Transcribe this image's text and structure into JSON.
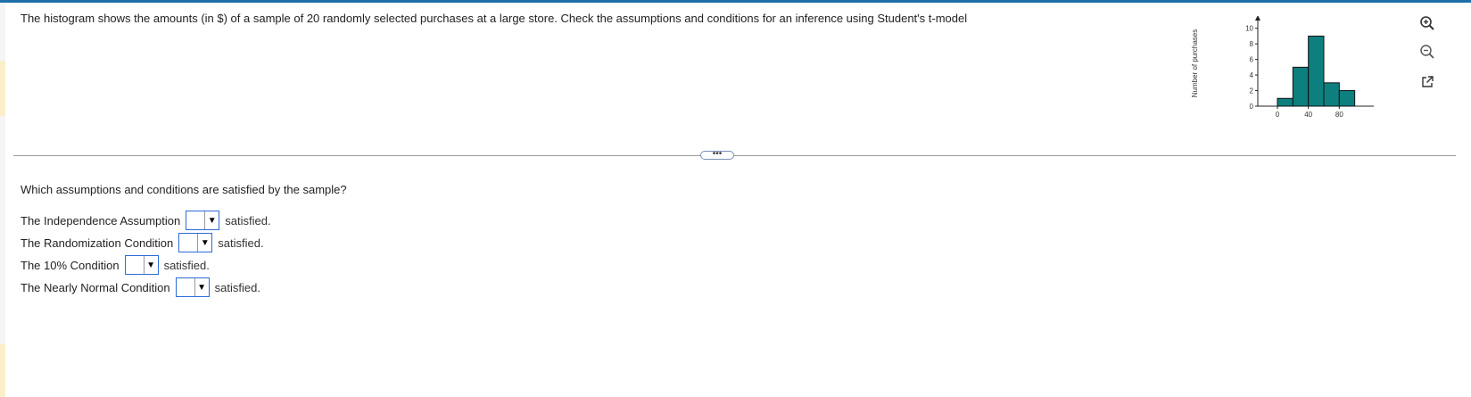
{
  "question": {
    "text": "The histogram shows the amounts (in $) of a sample of 20 randomly selected purchases at a large store. Check the assumptions and conditions for an inference using Student's t-model"
  },
  "divider": {
    "handle_label": "•••"
  },
  "prompt": "Which assumptions and conditions are satisfied by the sample?",
  "conditions": [
    {
      "label": "The Independence Assumption",
      "selected": "",
      "suffix": "satisfied."
    },
    {
      "label": "The Randomization Condition",
      "selected": "",
      "suffix": "satisfied."
    },
    {
      "label": "The 10% Condition",
      "selected": "",
      "suffix": "satisfied."
    },
    {
      "label": "The Nearly Normal Condition",
      "selected": "",
      "suffix": "satisfied."
    }
  ],
  "toolbar": {
    "icons": [
      "zoom-in-icon",
      "zoom-out-icon",
      "open-external-icon"
    ]
  },
  "colors": {
    "accent": "#1e6fa8",
    "bar_fill": "#0e7f7f",
    "dropdown_border": "#2d6bd6"
  },
  "chart_data": {
    "type": "bar",
    "ylabel": "Number of purchases",
    "xlabel": "",
    "bins": [
      {
        "from": 0,
        "to": 20,
        "count": 1
      },
      {
        "from": 20,
        "to": 40,
        "count": 5
      },
      {
        "from": 40,
        "to": 60,
        "count": 9
      },
      {
        "from": 60,
        "to": 80,
        "count": 3
      },
      {
        "from": 80,
        "to": 100,
        "count": 2
      }
    ],
    "x_ticks": [
      0,
      40,
      80
    ],
    "y_ticks": [
      0,
      2,
      4,
      6,
      8,
      10
    ],
    "xlim": [
      0,
      120
    ],
    "ylim": [
      0,
      11
    ]
  }
}
